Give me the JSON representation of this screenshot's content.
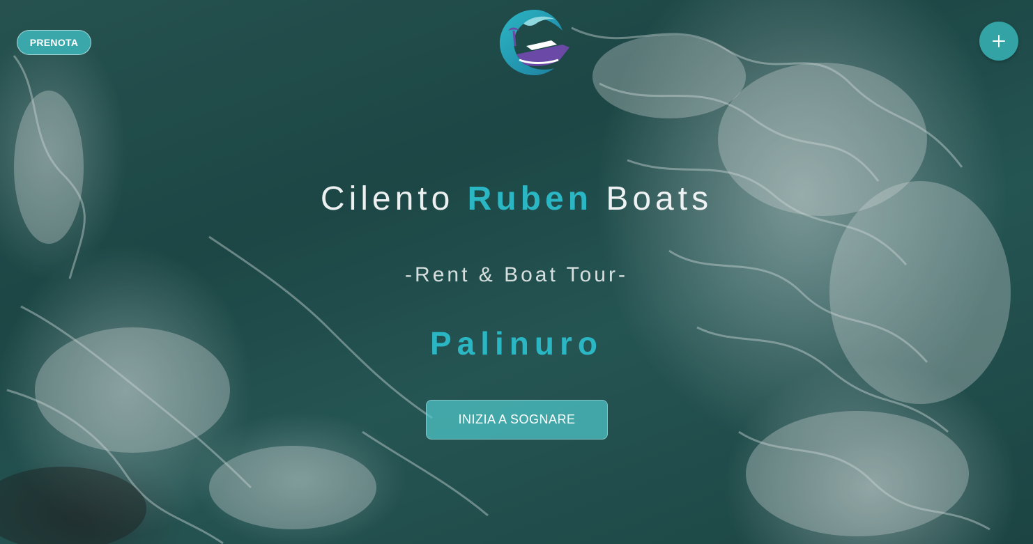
{
  "header": {
    "book_button_label": "PRENOTA",
    "menu_button_icon": "plus-icon",
    "logo_icon": "boat-wave-logo-icon"
  },
  "hero": {
    "title_part1": "Cilento ",
    "title_accent": "Ruben",
    "title_part2": " Boats",
    "subtitle": "-Rent & Boat Tour-",
    "place": "Palinuro",
    "cta_label": "INIZIA A SOGNARE"
  },
  "colors": {
    "accent": "#2bb6c4",
    "button_teal": "#3aa7aa",
    "cta_teal": "#4fc8cb"
  }
}
